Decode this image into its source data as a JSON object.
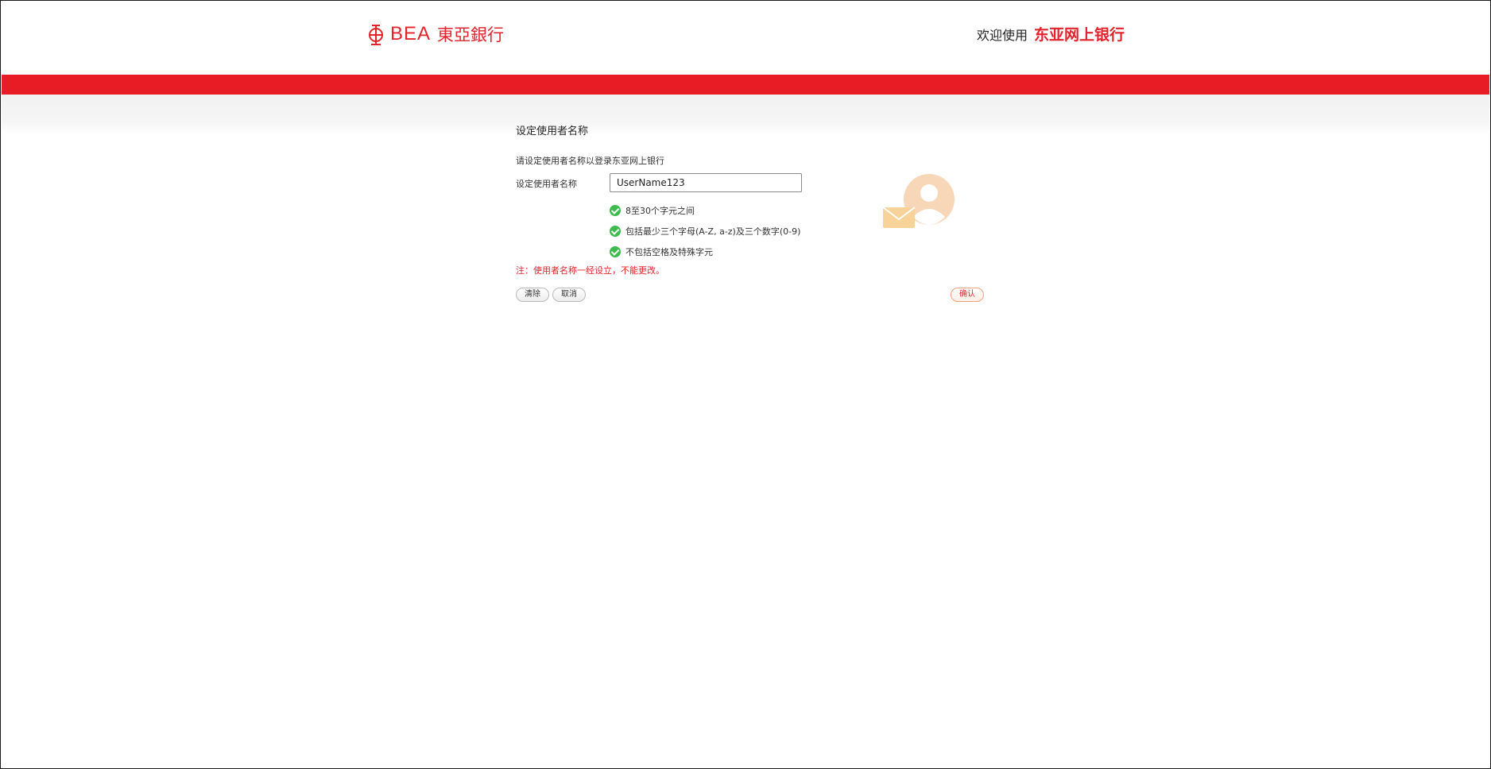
{
  "header": {
    "logo_brand": "BEA",
    "logo_cn": "東亞銀行",
    "welcome_prefix": "欢迎使用",
    "welcome_product": "东亚网上银行"
  },
  "form": {
    "title": "设定使用者名称",
    "intro": "请设定使用者名称以登录东亚网上银行",
    "field_label": "设定使用者名称",
    "username_value": "UserName123",
    "rules": [
      "8至30个字元之间",
      "包括最少三个字母(A-Z, a-z)及三个数字(0-9)",
      "不包括空格及特殊字元"
    ],
    "note": "注：使用者名称一经设立，不能更改。"
  },
  "buttons": {
    "clear": "清除",
    "cancel": "取消",
    "confirm": "确认"
  },
  "colors": {
    "brand_red": "#e81c24",
    "check_green": "#3dbb4d",
    "illustration_orange": "#f5c9a0",
    "envelope_yellow": "#f7d39a"
  },
  "icons": {
    "logo": "bea-emblem-icon",
    "check": "check-circle-icon",
    "illustration": "user-envelope-icon"
  }
}
